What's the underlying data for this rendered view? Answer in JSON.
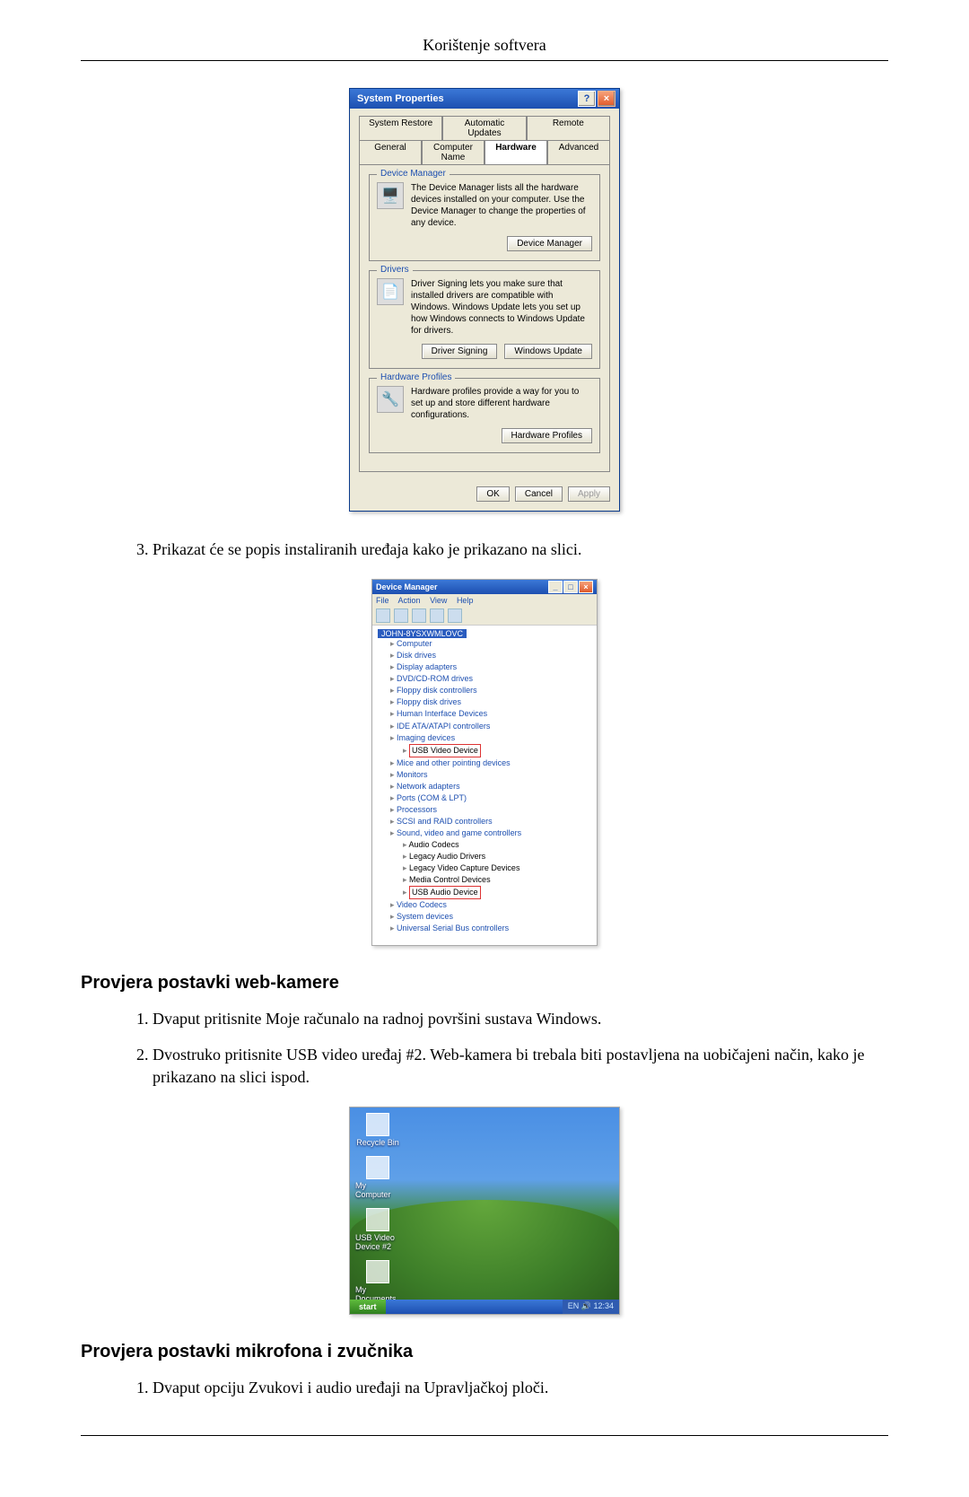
{
  "page": {
    "header": "Korištenje softvera"
  },
  "sysprop": {
    "title": "System Properties",
    "help_btn": "?",
    "close_btn": "×",
    "tabs_row1": [
      "System Restore",
      "Automatic Updates",
      "Remote"
    ],
    "tabs_row2": [
      "General",
      "Computer Name",
      "Hardware",
      "Advanced"
    ],
    "active_tab": "Hardware",
    "device_manager": {
      "legend": "Device Manager",
      "text": "The Device Manager lists all the hardware devices installed on your computer. Use the Device Manager to change the properties of any device.",
      "button": "Device Manager"
    },
    "drivers": {
      "legend": "Drivers",
      "text": "Driver Signing lets you make sure that installed drivers are compatible with Windows. Windows Update lets you set up how Windows connects to Windows Update for drivers.",
      "button1": "Driver Signing",
      "button2": "Windows Update"
    },
    "hardware_profiles": {
      "legend": "Hardware Profiles",
      "text": "Hardware profiles provide a way for you to set up and store different hardware configurations.",
      "button": "Hardware Profiles"
    },
    "ok": "OK",
    "cancel": "Cancel",
    "apply": "Apply"
  },
  "step3": "Prikazat će se popis instaliranih uređaja kako je prikazano na slici.",
  "devmgr": {
    "title": "Device Manager",
    "menu": [
      "File",
      "Action",
      "View",
      "Help"
    ],
    "root": "JOHN-8YSXWMLOVC",
    "items": [
      "Computer",
      "Disk drives",
      "Display adapters",
      "DVD/CD-ROM drives",
      "Floppy disk controllers",
      "Floppy disk drives",
      "Human Interface Devices",
      "IDE ATA/ATAPI controllers",
      "Imaging devices"
    ],
    "usb_video": "USB Video Device",
    "items2": [
      "Mice and other pointing devices",
      "Monitors",
      "Network adapters",
      "Ports (COM & LPT)",
      "Processors",
      "SCSI and RAID controllers",
      "Sound, video and game controllers"
    ],
    "sound_children": [
      "Audio Codecs",
      "Legacy Audio Drivers",
      "Legacy Video Capture Devices",
      "Media Control Devices"
    ],
    "usb_audio": "USB Audio Device",
    "items3": [
      "Video Codecs",
      "System devices",
      "Universal Serial Bus controllers"
    ]
  },
  "section1": {
    "heading": "Provjera postavki web-kamere",
    "step1": "Dvaput pritisnite Moje računalo na radnoj površini sustava Windows.",
    "step2": "Dvostruko pritisnite USB video uređaj #2. Web-kamera bi trebala biti postavljena na uobičajeni način, kako je prikazano na slici ispod."
  },
  "desktop": {
    "icons": [
      "Recycle Bin",
      "My Computer",
      "USB Video Device #2",
      "My Documents"
    ],
    "start": "start",
    "tray": "EN  🔊 12:34"
  },
  "section2": {
    "heading": "Provjera postavki mikrofona i zvučnika",
    "step1": "Dvaput opciju Zvukovi i audio uređaji na Upravljačkoj ploči."
  }
}
